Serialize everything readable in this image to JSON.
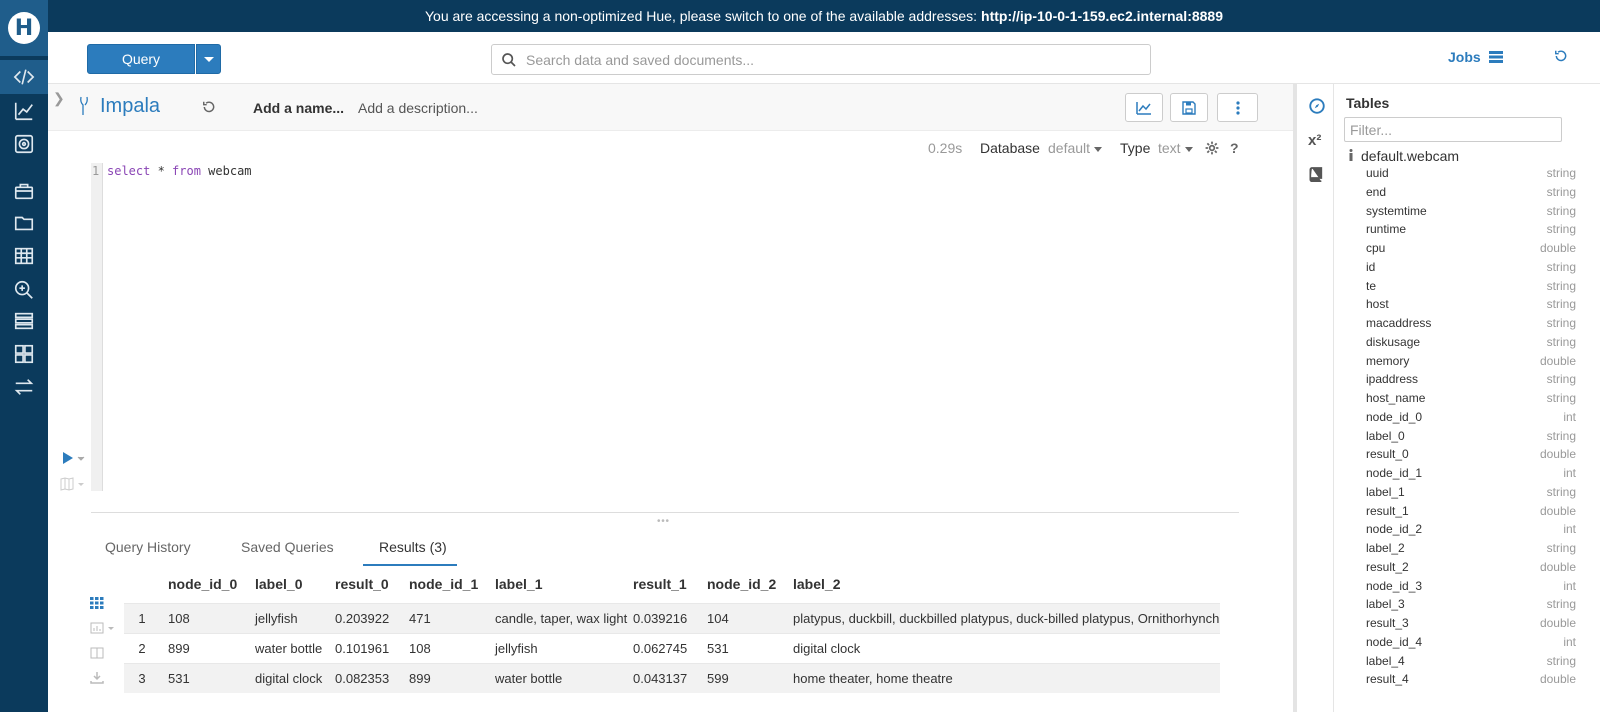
{
  "banner": {
    "message": "You are accessing a non-optimized Hue, please switch to one of the available addresses:",
    "address": "http://ip-10-0-1-159.ec2.internal:8889"
  },
  "header": {
    "query_label": "Query",
    "search_placeholder": "Search data and saved documents...",
    "jobs_label": "Jobs"
  },
  "rail": {
    "logo_letter": "H",
    "icons": [
      "code-icon",
      "chart-icon",
      "disc-icon",
      "briefcase-icon",
      "folder-icon",
      "table-icon",
      "search-zoom-icon",
      "rows-icon",
      "dashboard-icon",
      "transfer-icon"
    ]
  },
  "snippet": {
    "engine": "Impala",
    "name_placeholder": "Add a name...",
    "description_placeholder": "Add a description...",
    "exec_time": "0.29s",
    "database_label": "Database",
    "database_value": "default",
    "type_label": "Type",
    "type_value": "text",
    "help": "?",
    "line_number": "1",
    "code_keyword1": "select",
    "code_rest1": " * ",
    "code_keyword2": "from",
    "code_rest2": " webcam"
  },
  "tabs": [
    {
      "label": "Query History"
    },
    {
      "label": "Saved Queries"
    },
    {
      "label": "Results (3)"
    }
  ],
  "results": {
    "columns": [
      "node_id_0",
      "label_0",
      "result_0",
      "node_id_1",
      "label_1",
      "result_1",
      "node_id_2",
      "label_2"
    ],
    "rows": [
      {
        "num": "1",
        "cells": [
          "108",
          "jellyfish",
          "0.203922",
          "471",
          "candle, taper, wax light",
          "0.039216",
          "104",
          "platypus, duckbill, duckbilled platypus, duck-billed platypus, Ornithorhynchus an"
        ]
      },
      {
        "num": "2",
        "cells": [
          "899",
          "water bottle",
          "0.101961",
          "108",
          "jellyfish",
          "0.062745",
          "531",
          "digital clock"
        ]
      },
      {
        "num": "3",
        "cells": [
          "531",
          "digital clock",
          "0.082353",
          "899",
          "water bottle",
          "0.043137",
          "599",
          "home theater, home theatre"
        ]
      }
    ]
  },
  "assist": {
    "title": "Tables",
    "filter_placeholder": "Filter...",
    "table_name": "default.webcam",
    "x2_label": "x²",
    "columns": [
      {
        "name": "uuid",
        "type": "string"
      },
      {
        "name": "end",
        "type": "string"
      },
      {
        "name": "systemtime",
        "type": "string"
      },
      {
        "name": "runtime",
        "type": "string"
      },
      {
        "name": "cpu",
        "type": "double"
      },
      {
        "name": "id",
        "type": "string"
      },
      {
        "name": "te",
        "type": "string"
      },
      {
        "name": "host",
        "type": "string"
      },
      {
        "name": "macaddress",
        "type": "string"
      },
      {
        "name": "diskusage",
        "type": "string"
      },
      {
        "name": "memory",
        "type": "double"
      },
      {
        "name": "ipaddress",
        "type": "string"
      },
      {
        "name": "host_name",
        "type": "string"
      },
      {
        "name": "node_id_0",
        "type": "int"
      },
      {
        "name": "label_0",
        "type": "string"
      },
      {
        "name": "result_0",
        "type": "double"
      },
      {
        "name": "node_id_1",
        "type": "int"
      },
      {
        "name": "label_1",
        "type": "string"
      },
      {
        "name": "result_1",
        "type": "double"
      },
      {
        "name": "node_id_2",
        "type": "int"
      },
      {
        "name": "label_2",
        "type": "string"
      },
      {
        "name": "result_2",
        "type": "double"
      },
      {
        "name": "node_id_3",
        "type": "int"
      },
      {
        "name": "label_3",
        "type": "string"
      },
      {
        "name": "result_3",
        "type": "double"
      },
      {
        "name": "node_id_4",
        "type": "int"
      },
      {
        "name": "label_4",
        "type": "string"
      },
      {
        "name": "result_4",
        "type": "double"
      }
    ]
  },
  "colors": {
    "brand_blue": "#2c7cbd",
    "rail_bg": "#0b3a5c",
    "keyword": "#8a45b5"
  }
}
